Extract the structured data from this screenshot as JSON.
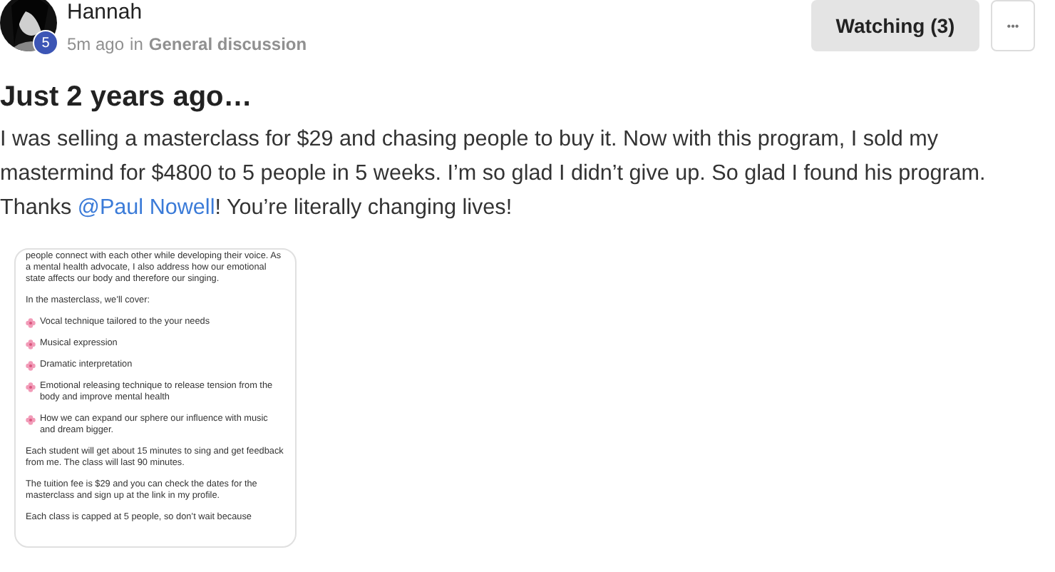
{
  "post": {
    "author": "Hannah",
    "level_badge": "5",
    "time": "5m ago",
    "in_word": "in",
    "category": "General discussion",
    "watch_button": "Watching (3)",
    "more_button": "•••",
    "title": "Just 2 years ago…",
    "body": [
      {
        "kind": "text",
        "text": "I was selling a masterclass for $29 and chasing people to buy it. Now with this program, I sold my mastermind for $4800 to 5 people in 5 weeks. I’m so glad I didn’t give up. So glad I found his program. Thanks "
      },
      {
        "kind": "mention",
        "text": "@Paul Nowell"
      },
      {
        "kind": "text",
        "text": "! You’re literally changing lives!"
      }
    ],
    "attachment": {
      "blocks": [
        {
          "kind": "text",
          "text": "people connect with each other while developing their voice. As a mental health advocate, I also address how our emotional state affects our body and therefore our singing."
        },
        {
          "kind": "text",
          "text": "In the masterclass, we’ll cover:"
        },
        {
          "kind": "bullet",
          "text": "Vocal technique tailored to the your needs"
        },
        {
          "kind": "bullet",
          "text": "Musical expression"
        },
        {
          "kind": "bullet",
          "text": "Dramatic interpretation"
        },
        {
          "kind": "bullet",
          "text": "Emotional releasing technique to release tension from the body and improve mental health"
        },
        {
          "kind": "bullet",
          "text": "How we can expand our sphere our influence with music and dream bigger."
        },
        {
          "kind": "text",
          "text": "Each student will get about 15 minutes to sing and get feedback from me. The class will last 90 minutes."
        },
        {
          "kind": "text",
          "text": "The tuition fee is $29 and you can check the dates for the masterclass and sign up at the link in my profile."
        },
        {
          "kind": "text",
          "text": "Each class is capped at 5 people, so don’t wait because"
        }
      ]
    }
  }
}
